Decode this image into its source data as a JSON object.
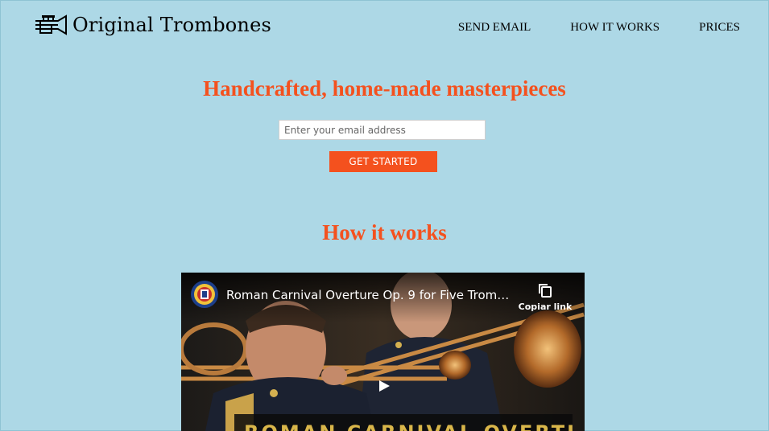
{
  "brand": {
    "name": "Original Trombones",
    "logo_icon": "trombone-icon"
  },
  "nav": {
    "items": [
      {
        "label": "SEND EMAIL"
      },
      {
        "label": "HOW IT WORKS"
      },
      {
        "label": "PRICES"
      }
    ]
  },
  "hero": {
    "title": "Handcrafted, home-made masterpieces",
    "email_placeholder": "Enter your email address",
    "email_value": "",
    "cta_label": "GET STARTED"
  },
  "how_it_works": {
    "title": "How it works"
  },
  "video": {
    "title": "Roman Carnival Overture Op. 9 for Five Trombon...",
    "copy_link_label": "Copiar link",
    "caption": "ROMAN CARNIVAL OVERTURE",
    "play_icon": "play-icon",
    "copy_icon": "copy-icon"
  },
  "colors": {
    "background": "#add8e6",
    "accent": "#f4511e",
    "text": "#000000"
  }
}
